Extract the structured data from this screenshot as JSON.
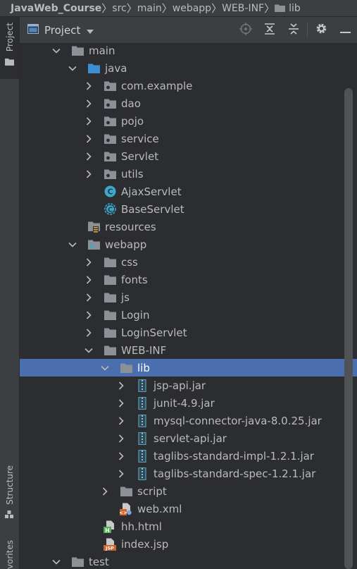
{
  "breadcrumb": [
    "JavaWeb_Course",
    "src",
    "main",
    "webapp",
    "WEB-INF",
    "lib"
  ],
  "left_stripe": {
    "project": "Project",
    "structure": "Structure",
    "favorites": "Favorites"
  },
  "panel": {
    "title": "Project"
  },
  "colors": {
    "selection": "#4b6eaf",
    "folder": "#8c9198",
    "source_folder": "#3d8fd1",
    "class_icon": "#3fa6c9",
    "jar_icon": "#5e9bb4"
  },
  "tree": [
    {
      "label": "main",
      "depth": 0,
      "expanded": true,
      "icon": "folder-icon"
    },
    {
      "label": "java",
      "depth": 1,
      "expanded": true,
      "icon": "source-folder-icon"
    },
    {
      "label": "com.example",
      "depth": 2,
      "expanded": false,
      "icon": "package-icon"
    },
    {
      "label": "dao",
      "depth": 2,
      "expanded": false,
      "icon": "package-icon"
    },
    {
      "label": "pojo",
      "depth": 2,
      "expanded": false,
      "icon": "package-icon"
    },
    {
      "label": "service",
      "depth": 2,
      "expanded": false,
      "icon": "package-icon"
    },
    {
      "label": "Servlet",
      "depth": 2,
      "expanded": false,
      "icon": "package-icon"
    },
    {
      "label": "utils",
      "depth": 2,
      "expanded": false,
      "icon": "package-icon"
    },
    {
      "label": "AjaxServlet",
      "depth": 2,
      "leaf": true,
      "icon": "class-icon"
    },
    {
      "label": "BaseServlet",
      "depth": 2,
      "leaf": true,
      "icon": "abstract-class-icon"
    },
    {
      "label": "resources",
      "depth": 1,
      "leaf": true,
      "icon": "resources-folder-icon"
    },
    {
      "label": "webapp",
      "depth": 1,
      "expanded": true,
      "icon": "web-folder-icon"
    },
    {
      "label": "css",
      "depth": 2,
      "expanded": false,
      "icon": "folder-icon"
    },
    {
      "label": "fonts",
      "depth": 2,
      "expanded": false,
      "icon": "folder-icon"
    },
    {
      "label": "js",
      "depth": 2,
      "expanded": false,
      "icon": "folder-icon"
    },
    {
      "label": "Login",
      "depth": 2,
      "expanded": false,
      "icon": "folder-icon"
    },
    {
      "label": "LoginServlet",
      "depth": 2,
      "expanded": false,
      "icon": "folder-icon"
    },
    {
      "label": "WEB-INF",
      "depth": 2,
      "expanded": true,
      "icon": "folder-icon"
    },
    {
      "label": "lib",
      "depth": 3,
      "expanded": true,
      "icon": "folder-icon",
      "selected": true
    },
    {
      "label": "jsp-api.jar",
      "depth": 4,
      "expanded": false,
      "icon": "jar-icon"
    },
    {
      "label": "junit-4.9.jar",
      "depth": 4,
      "expanded": false,
      "icon": "jar-icon"
    },
    {
      "label": "mysql-connector-java-8.0.25.jar",
      "depth": 4,
      "expanded": false,
      "icon": "jar-icon"
    },
    {
      "label": "servlet-api.jar",
      "depth": 4,
      "expanded": false,
      "icon": "jar-icon"
    },
    {
      "label": "taglibs-standard-impl-1.2.1.jar",
      "depth": 4,
      "expanded": false,
      "icon": "jar-icon"
    },
    {
      "label": "taglibs-standard-spec-1.2.1.jar",
      "depth": 4,
      "expanded": false,
      "icon": "jar-icon"
    },
    {
      "label": "script",
      "depth": 3,
      "expanded": false,
      "icon": "folder-icon"
    },
    {
      "label": "web.xml",
      "depth": 3,
      "leaf": true,
      "icon": "web-xml-icon"
    },
    {
      "label": "hh.html",
      "depth": 2,
      "leaf": true,
      "icon": "html-file-icon"
    },
    {
      "label": "index.jsp",
      "depth": 2,
      "leaf": true,
      "icon": "jsp-file-icon"
    },
    {
      "label": "test",
      "depth": 0,
      "expanded": true,
      "icon": "folder-icon"
    }
  ]
}
